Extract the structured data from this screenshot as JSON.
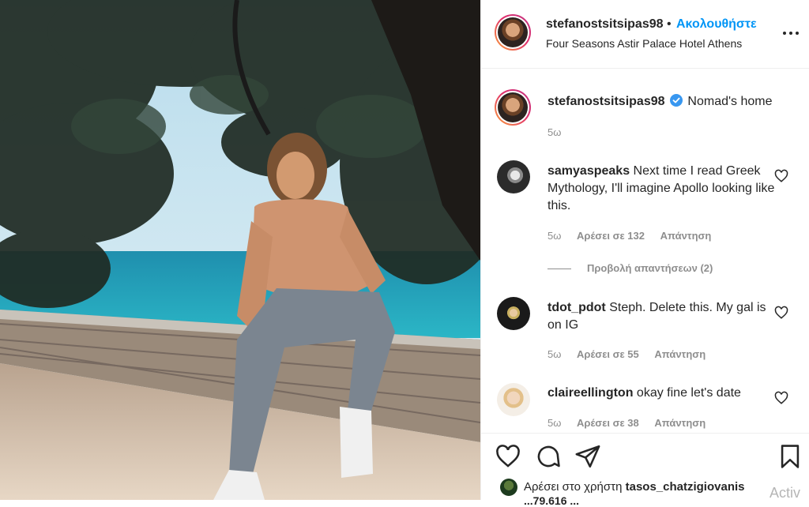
{
  "header": {
    "username": "stefanostsitsipas98",
    "separator": "•",
    "follow_label": "Ακολουθήστε",
    "location": "Four Seasons Astir Palace Hotel Athens"
  },
  "caption": {
    "username": "stefanostsitsipas98",
    "verified_icon": "verified-badge-icon",
    "text": "Nomad's home",
    "time": "5ω"
  },
  "comments": [
    {
      "username": "samyaspeaks",
      "text": "Next time I read Greek Mythology, I'll imagine Apollo looking like this.",
      "time": "5ω",
      "likes": "Αρέσει σε 132",
      "reply": "Απάντηση"
    },
    {
      "username": "tdot_pdot",
      "text": "Steph. Delete this. My gal is on IG",
      "time": "5ω",
      "likes": "Αρέσει σε 55",
      "reply": "Απάντηση"
    },
    {
      "username": "claireellington",
      "text": "okay fine let's date",
      "time": "5ω",
      "likes": "Αρέσει σε 38",
      "reply": "Απάντηση"
    }
  ],
  "view_replies": "Προβολή απαντήσεων (2)",
  "liked_by": {
    "prefix": "Αρέσει στο χρήστη",
    "user": "tasos_chatzigiovanis"
  },
  "likes_partial": "...79.616 ...",
  "watermark": "Activ",
  "colors": {
    "link": "#0095f6",
    "text": "#262626",
    "muted": "#8e8e8e",
    "border": "#efefef"
  }
}
